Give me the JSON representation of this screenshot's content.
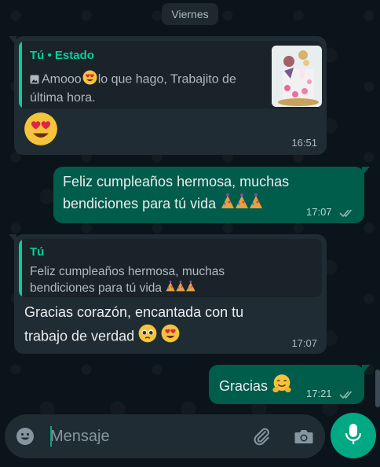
{
  "day_separator": "Viernes",
  "messages": [
    {
      "direction": "incoming",
      "quote": {
        "author": "Tú • Estado",
        "text_line1": "Amooo",
        "text_line1b": "lo que hago, Trabajito de",
        "text_line2": "última hora.",
        "thumbnail": "cake-photo"
      },
      "body_emoji": "heart-eyes-emoji",
      "time": "16:51"
    },
    {
      "direction": "outgoing",
      "text_line1": "Feliz cumpleaños hermosa, muchas",
      "text_line2": "bendiciones para tú vida",
      "emojis": "party-emojis",
      "time": "17:07",
      "status": "read"
    },
    {
      "direction": "incoming",
      "quote": {
        "author": "Tú",
        "text_line1": "Feliz cumpleaños hermosa, muchas",
        "text_line2": "bendiciones para tú vida"
      },
      "text_line1": "Gracias  corazón, encantada con tu",
      "text_line2": "trabajo de verdad",
      "time": "17:07"
    },
    {
      "direction": "outgoing",
      "text": "Gracias",
      "time": "17:21",
      "status": "read"
    }
  ],
  "composer": {
    "placeholder": "Mensaje"
  },
  "colors": {
    "background": "#0b141a",
    "incoming_bubble": "#202c33",
    "outgoing_bubble": "#005c4b",
    "accent": "#00a884",
    "quote_author": "#06cf9c",
    "read_ticks": "#8fb7ad"
  },
  "icons": {
    "emoji": "emoji-icon",
    "attach": "paperclip-icon",
    "camera": "camera-icon",
    "mic": "microphone-icon"
  }
}
